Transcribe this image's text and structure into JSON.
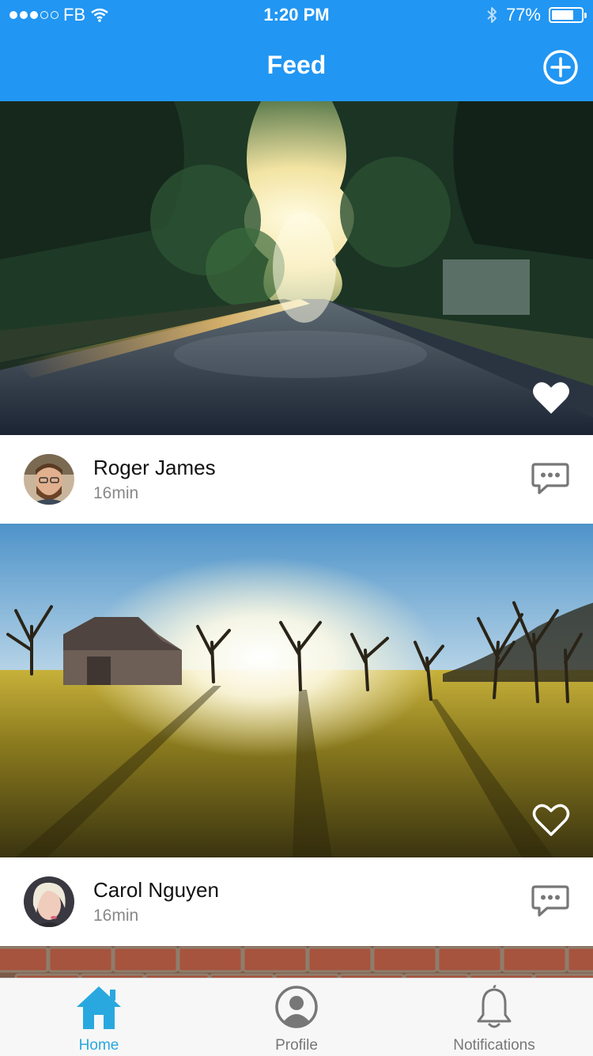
{
  "status": {
    "carrier": "FB",
    "time": "1:20 PM",
    "battery": "77%",
    "battery_level": 0.77
  },
  "nav": {
    "title": "Feed",
    "add_icon": "plus-circle-icon"
  },
  "posts": [
    {
      "author": "Roger James",
      "time": "16min",
      "liked": true,
      "image": "tree-lined road at sunset",
      "like_icon": "heart-filled-icon",
      "comment_icon": "chat-bubble-icon"
    },
    {
      "author": "Carol Nguyen",
      "time": "16min",
      "liked": false,
      "image": "meadow with barn and trees at sunrise",
      "like_icon": "heart-outline-icon",
      "comment_icon": "chat-bubble-icon"
    }
  ],
  "tabs": [
    {
      "label": "Home",
      "icon": "home-icon",
      "active": true
    },
    {
      "label": "Profile",
      "icon": "profile-icon",
      "active": false
    },
    {
      "label": "Notifications",
      "icon": "bell-icon",
      "active": false
    }
  ],
  "colors": {
    "primary": "#2196F3",
    "tab_active": "#29A8E0",
    "tab_inactive": "#777777"
  }
}
